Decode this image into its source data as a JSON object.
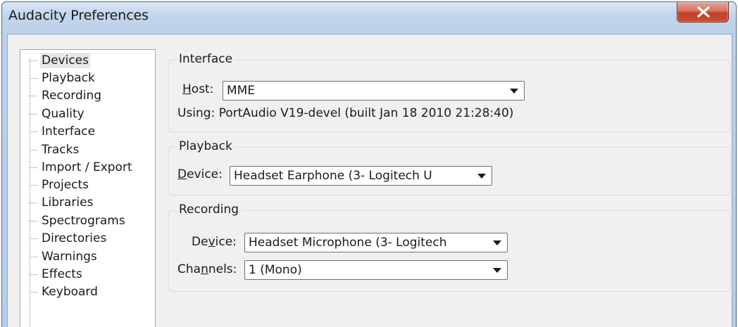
{
  "window": {
    "title": "Audacity Preferences",
    "close_icon": "close-x-icon"
  },
  "sidebar": {
    "items": [
      {
        "label": "Devices",
        "selected": true
      },
      {
        "label": "Playback"
      },
      {
        "label": "Recording"
      },
      {
        "label": "Quality"
      },
      {
        "label": "Interface"
      },
      {
        "label": "Tracks"
      },
      {
        "label": "Import / Export"
      },
      {
        "label": "Projects"
      },
      {
        "label": "Libraries"
      },
      {
        "label": "Spectrograms"
      },
      {
        "label": "Directories"
      },
      {
        "label": "Warnings"
      },
      {
        "label": "Effects"
      },
      {
        "label": "Keyboard"
      }
    ]
  },
  "interface": {
    "group_title": "Interface",
    "host_label_u": "H",
    "host_label_rest": "ost:",
    "host_value": "MME",
    "using_text": "Using: PortAudio V19-devel (built Jan 18 2010 21:28:40)"
  },
  "playback": {
    "group_title": "Playback",
    "device_label_u": "D",
    "device_label_rest": "evice:",
    "device_value": "Headset Earphone (3- Logitech U"
  },
  "recording": {
    "group_title": "Recording",
    "device_label_pre": "De",
    "device_label_u": "v",
    "device_label_rest": "ice:",
    "device_value": "Headset Microphone (3- Logitech",
    "channels_label_pre": "Cha",
    "channels_label_u": "n",
    "channels_label_rest": "nels:",
    "channels_value": "1 (Mono)"
  }
}
